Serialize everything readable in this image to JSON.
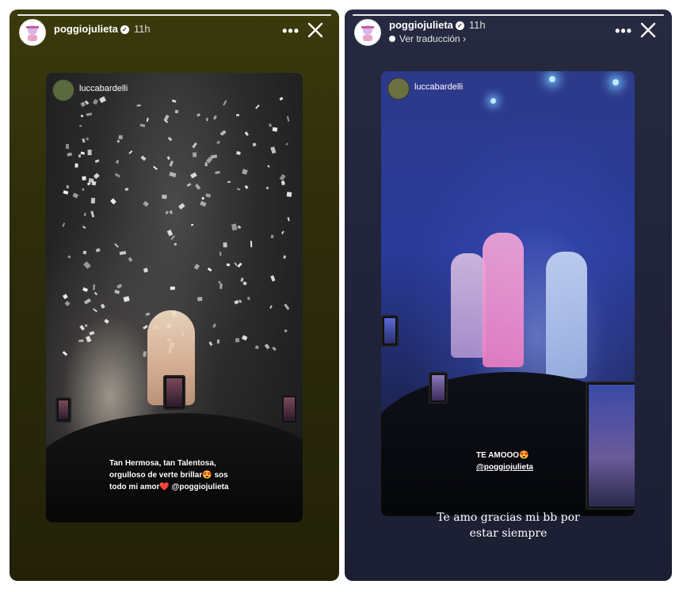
{
  "stories": [
    {
      "username": "poggiojulieta",
      "time": "11h",
      "repost_user": "luccabardelli",
      "caption_lines": [
        "Tan Hermosa, tan Talentosa,",
        "orgulloso de verte brillar😍 sos",
        "todo mi amor❤️"
      ],
      "mention": "@poggiojulieta"
    },
    {
      "username": "poggiojulieta",
      "time": "11h",
      "translate_label": "Ver traducción",
      "repost_user": "luccabardelli",
      "caption_line": "TE AMOOO😍",
      "mention": "@poggiojulieta",
      "bottom_text_lines": [
        "Te amo gracias mi bb por",
        "estar siempre"
      ]
    }
  ],
  "icons": [
    "more-options-icon",
    "close-icon",
    "verified-icon",
    "chevron-right-icon"
  ],
  "colors": {
    "left_bg": "#2d2c0b",
    "right_bg": "#20233a"
  }
}
